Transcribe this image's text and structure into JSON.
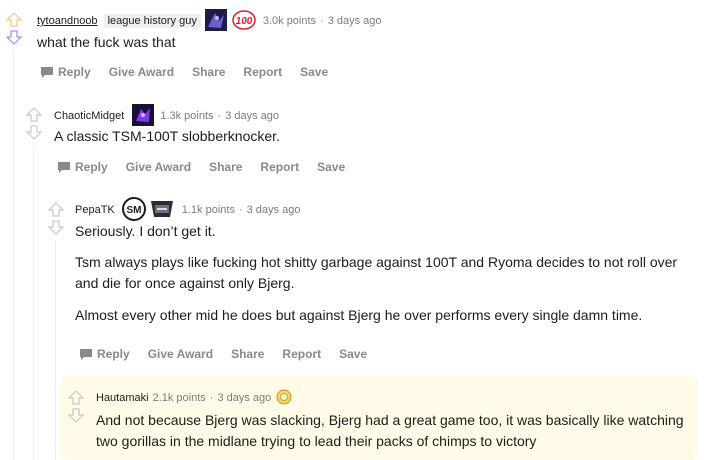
{
  "colors": {
    "upvote": "#f7c680",
    "downvote": "#9494ff",
    "meta_gray": "#7c7c7c",
    "action_gray": "#878a8c",
    "highlight": "#fffbe6"
  },
  "comments": [
    {
      "username": "tytoandnoob",
      "flair_text": "league history guy",
      "flair_icons": [
        "champion-flair-icon",
        "100t-logo-icon"
      ],
      "points": "3.0k points",
      "separator": "·",
      "time": "3 days ago",
      "body": [
        "what the fuck was that"
      ]
    },
    {
      "username": "ChaoticMidget",
      "flair_icons": [
        "champion-flair-icon"
      ],
      "points": "1.3k points",
      "separator": "·",
      "time": "3 days ago",
      "body": [
        "A classic TSM-100T slobberknocker."
      ]
    },
    {
      "username": "PepaTK",
      "flair_icons": [
        "tsm-logo-icon",
        "lcs-logo-icon"
      ],
      "points": "1.1k points",
      "separator": "·",
      "time": "3 days ago",
      "body": [
        "Seriously. I don’t get it.",
        "Tsm always plays like fucking hot shitty garbage against 100T and Ryoma decides to not roll over and die for once against only Bjerg.",
        "Almost every other mid he does but against Bjerg he over performs every single damn time."
      ]
    },
    {
      "username": "Hautamaki",
      "points": "2.1k points",
      "separator": "·",
      "time": "3 days ago",
      "award_icon": "award-icon",
      "body": [
        "And not because Bjerg was slacking, Bjerg had a great game too, it was basically like watching two gorillas in the midlane trying to lead their packs of chimps to victory"
      ]
    }
  ],
  "actions": {
    "reply": "Reply",
    "give_award": "Give Award",
    "share": "Share",
    "report": "Report",
    "save": "Save"
  }
}
